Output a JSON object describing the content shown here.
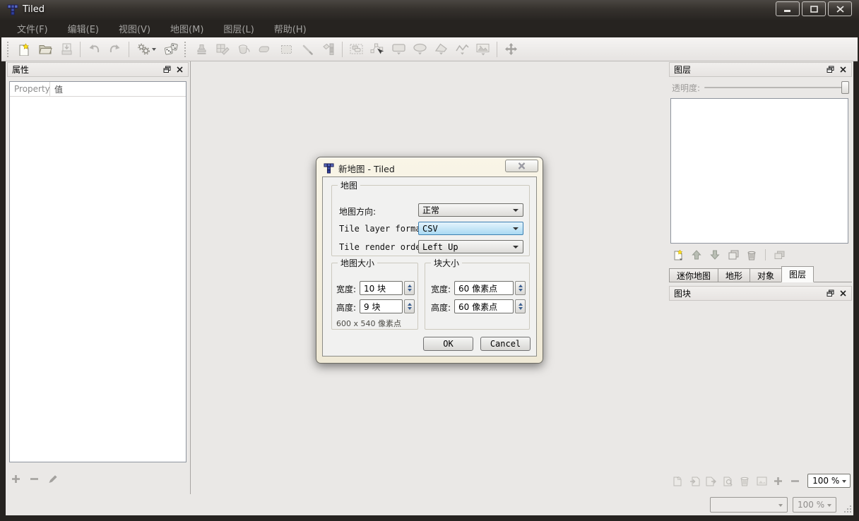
{
  "window": {
    "title": "Tiled"
  },
  "titlebar": {
    "buttons": [
      "minimize",
      "maximize",
      "close"
    ]
  },
  "menu": {
    "items": [
      "文件(F)",
      "编辑(E)",
      "视图(V)",
      "地图(M)",
      "图层(L)",
      "帮助(H)"
    ]
  },
  "toolbar": {
    "icons": [
      "new-map",
      "open-file",
      "save-file",
      "undo",
      "redo",
      "execute-commands",
      "random-mode",
      "stamp-brush",
      "terrain-brush",
      "bucket-fill",
      "eraser",
      "rectangular-select",
      "magic-wand",
      "select-same-tile",
      "select-objects",
      "edit-polygons",
      "insert-rectangle",
      "insert-ellipse",
      "insert-polygon",
      "insert-polyline",
      "insert-tile",
      "pan-tool"
    ]
  },
  "properties_panel": {
    "title": "属性",
    "col_property": "Property",
    "col_value": "值",
    "footer_icons": [
      "add-property",
      "remove-property",
      "edit-property"
    ]
  },
  "layers_panel": {
    "title": "图层",
    "opacity_label": "透明度:",
    "toolbar_icons": [
      "new-layer",
      "raise-layer",
      "lower-layer",
      "duplicate-layer",
      "delete-layer",
      "highlight-layer"
    ],
    "tabs": [
      "迷你地图",
      "地形",
      "对象",
      "图层"
    ],
    "active_tab": "图层"
  },
  "tilesets_panel": {
    "title": "图块",
    "toolbar_icons": [
      "new-tileset",
      "import-tileset",
      "export-tileset",
      "tileset-properties",
      "delete-tileset",
      "edit-tileset",
      "zoom-in",
      "zoom-out"
    ],
    "zoom_value": "100 %"
  },
  "statusbar": {
    "layer_combo_value": "",
    "zoom_value": "100 %"
  },
  "dialog": {
    "title": "新地图 - Tiled",
    "map_group": {
      "label": "地图",
      "orientation_label": "地图方向:",
      "orientation_value": "正常",
      "layer_format_label": "Tile layer format:",
      "layer_format_value": "CSV",
      "render_order_label": "Tile render order:",
      "render_order_value": "Left Up"
    },
    "map_size_group": {
      "label": "地图大小",
      "width_label": "宽度:",
      "width_value": "10 块",
      "height_label": "高度:",
      "height_value": "9 块",
      "pixel_note": "600 x 540 像素点"
    },
    "tile_size_group": {
      "label": "块大小",
      "width_label": "宽度:",
      "width_value": "60 像素点",
      "height_label": "高度:",
      "height_value": "60 像素点"
    },
    "buttons": {
      "ok": "OK",
      "cancel": "Cancel"
    }
  },
  "colors": {
    "focus_border": "#3c7fb1",
    "focus_fill": "#a9d9f2",
    "frame_dark": "#262320",
    "accent_star": "#ffe11a"
  }
}
